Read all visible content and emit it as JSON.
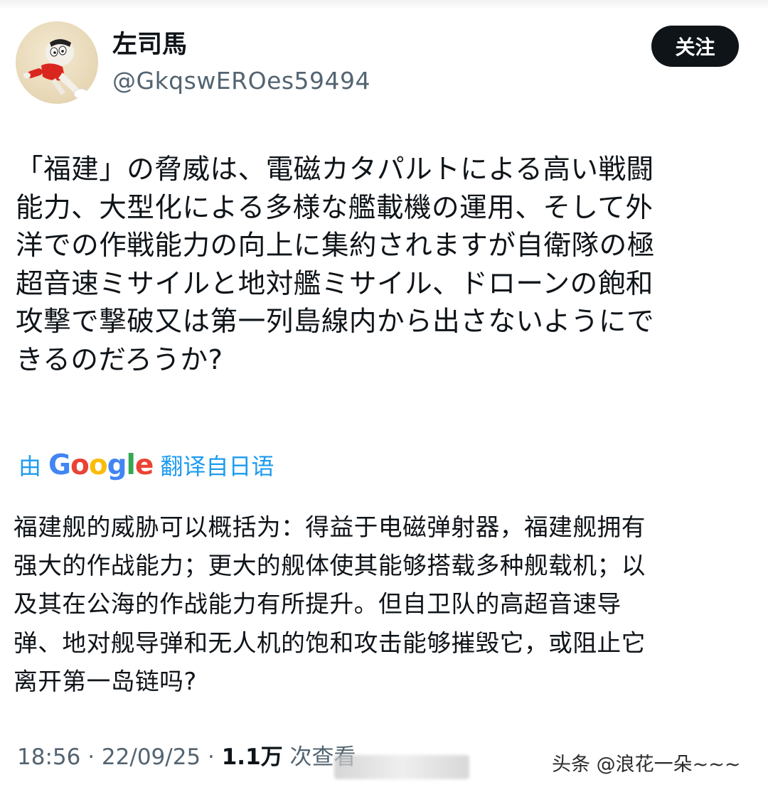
{
  "user": {
    "display_name": "左司馬",
    "handle": "@GkqswEROes59494"
  },
  "follow_label": "关注",
  "post": {
    "original_text": "「福建」の脅威は、電磁カタパルトによる高い戦闘\n能力、大型化による多様な艦載機の運用、そして外\n洋での作戦能力の向上に集約されますが自衛隊の極\n超音速ミサイルと地対艦ミサイル、ドローンの飽和\n攻撃で撃破又は第一列島線内から出さないようにで\nきるのだろうか?",
    "translate_prefix": "由",
    "translate_brand": "Google",
    "translate_suffix": "翻译自日语",
    "translated_text": "福建舰的威胁可以概括为：得益于电磁弹射器，福建舰拥有\n强大的作战能力；更大的舰体使其能够搭载多种舰载机；以\n及其在公海的作战能力有所提升。但自卫队的高超音速导\n弹、地对舰导弹和无人机的饱和攻击能够摧毁它，或阻止它\n离开第一岛链吗?",
    "time": "18:56",
    "date": "22/09/25",
    "separator": "·",
    "views": "1.1万",
    "views_label": "次查看"
  },
  "watermark": "头条 @浪花一朵~~~"
}
